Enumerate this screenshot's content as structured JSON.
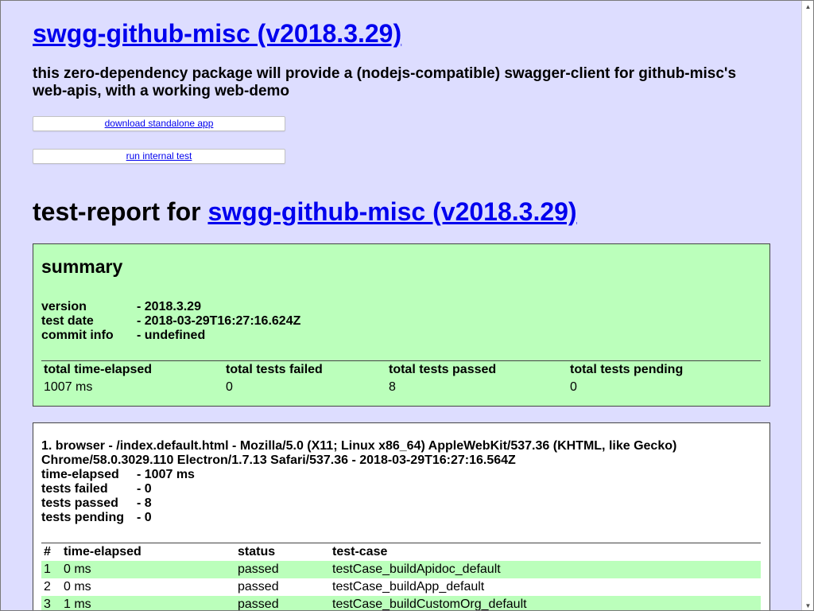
{
  "package": {
    "title": "swgg-github-misc (v2018.3.29)",
    "description": "this zero-dependency package will provide a (nodejs-compatible) swagger-client for github-misc's web-apis, with a working web-demo",
    "download_label": "download standalone app",
    "test_label": "run internal test"
  },
  "report": {
    "title_prefix": "test-report for ",
    "title_link": "swgg-github-misc (v2018.3.29)"
  },
  "summary": {
    "heading": "summary",
    "info": [
      {
        "key": "version",
        "value": "2018.3.29"
      },
      {
        "key": "test date",
        "value": "2018-03-29T16:27:16.624Z"
      },
      {
        "key": "commit info",
        "value": "undefined"
      }
    ],
    "stats_headers": [
      "total time-elapsed",
      "total tests failed",
      "total tests passed",
      "total tests pending"
    ],
    "stats_values": [
      "1007 ms",
      "0",
      "8",
      "0"
    ]
  },
  "environment": {
    "title": "1. browser - /index.default.html - Mozilla/5.0 (X11; Linux x86_64) AppleWebKit/537.36 (KHTML, like Gecko) Chrome/58.0.3029.110 Electron/1.7.13 Safari/537.36 - 2018-03-29T16:27:16.564Z",
    "info": [
      {
        "key": "time-elapsed",
        "value": "1007 ms"
      },
      {
        "key": "tests failed",
        "value": "0"
      },
      {
        "key": "tests passed",
        "value": "8"
      },
      {
        "key": "tests pending",
        "value": "0"
      }
    ],
    "case_headers": [
      "#",
      "time-elapsed",
      "status",
      "test-case"
    ],
    "cases": [
      {
        "num": "1",
        "time": "0 ms",
        "status": "passed",
        "name": "testCase_buildApidoc_default"
      },
      {
        "num": "2",
        "time": "0 ms",
        "status": "passed",
        "name": "testCase_buildApp_default"
      },
      {
        "num": "3",
        "time": "1 ms",
        "status": "passed",
        "name": "testCase_buildCustomOrg_default"
      }
    ]
  },
  "colors": {
    "page_background": "#ddddff",
    "passed_background": "#bbffbb",
    "link": "#0000ee"
  }
}
